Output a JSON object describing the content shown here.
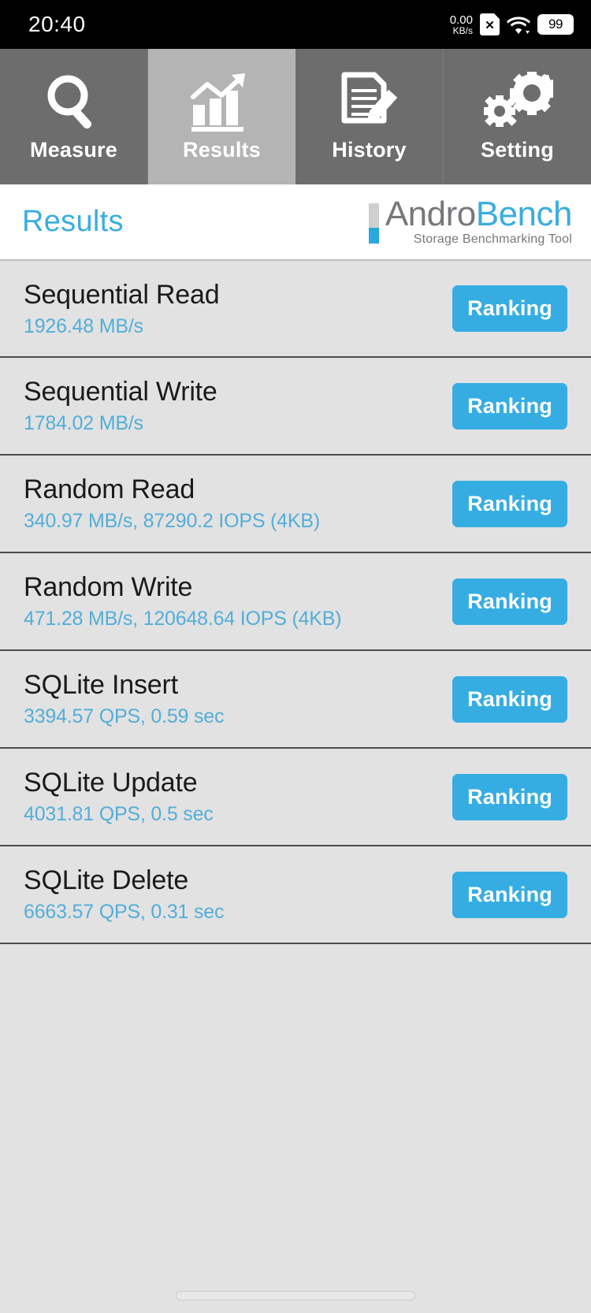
{
  "statusbar": {
    "time": "20:40",
    "network_rate": "0.00",
    "network_unit": "KB/s",
    "sim_icon": "sim-card-off-icon",
    "sim_glyph": "✕",
    "wifi_icon": "wifi-icon",
    "battery_level": "99"
  },
  "tabs": [
    {
      "label": "Measure",
      "icon": "magnifier-icon",
      "active": false
    },
    {
      "label": "Results",
      "icon": "bar-chart-trend-icon",
      "active": true
    },
    {
      "label": "History",
      "icon": "document-pencil-icon",
      "active": false
    },
    {
      "label": "Setting",
      "icon": "gears-icon",
      "active": false
    }
  ],
  "header": {
    "title": "Results",
    "logo_andro": "Andro",
    "logo_bench": "Bench",
    "tagline": "Storage Benchmarking Tool"
  },
  "results": [
    {
      "name": "Sequential Read",
      "value": "1926.48 MB/s",
      "button": "Ranking"
    },
    {
      "name": "Sequential Write",
      "value": "1784.02 MB/s",
      "button": "Ranking"
    },
    {
      "name": "Random Read",
      "value": "340.97 MB/s, 87290.2 IOPS (4KB)",
      "button": "Ranking"
    },
    {
      "name": "Random Write",
      "value": "471.28 MB/s, 120648.64 IOPS (4KB)",
      "button": "Ranking"
    },
    {
      "name": "SQLite Insert",
      "value": "3394.57 QPS, 0.59 sec",
      "button": "Ranking"
    },
    {
      "name": "SQLite Update",
      "value": "4031.81 QPS, 0.5 sec",
      "button": "Ranking"
    },
    {
      "name": "SQLite Delete",
      "value": "6663.57 QPS, 0.31 sec",
      "button": "Ranking"
    }
  ],
  "colors": {
    "accent_blue": "#35ade3",
    "value_blue": "#53aed8",
    "logo_gray": "#77787b",
    "tab_inactive": "#6d6d6d",
    "tab_active": "#b4b4b4",
    "page_bg": "#e2e2e2"
  }
}
